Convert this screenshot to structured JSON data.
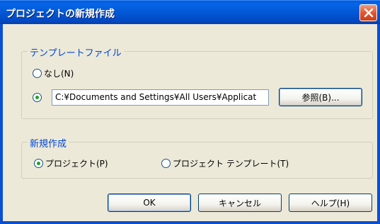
{
  "window": {
    "title": "プロジェクトの新規作成",
    "close_label": "close"
  },
  "template_file": {
    "legend": "テンプレートファイル",
    "options": [
      {
        "label": "なし(N)",
        "selected": false
      },
      {
        "label": "",
        "selected": true
      }
    ],
    "path_value": "C:¥Documents and Settings¥All Users¥Applicat",
    "browse_label": "参照(B)..."
  },
  "new_create": {
    "legend": "新規作成",
    "options": [
      {
        "label": "プロジェクト(P)",
        "selected": true
      },
      {
        "label": "プロジェクト テンプレート(T)",
        "selected": false
      }
    ]
  },
  "buttons": {
    "ok": "OK",
    "cancel": "キャンセル",
    "help": "ヘルプ(H)"
  }
}
